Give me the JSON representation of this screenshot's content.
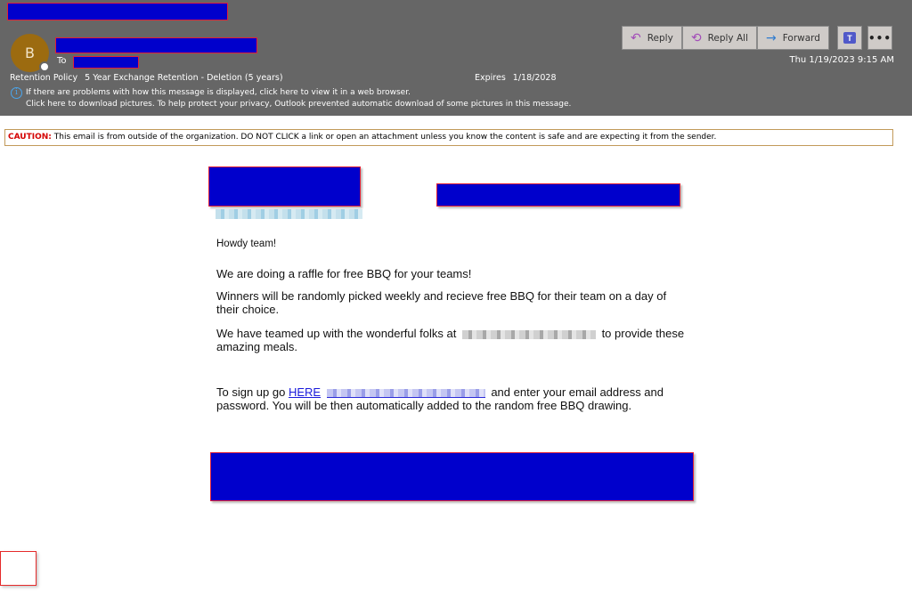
{
  "header": {
    "avatar_initial": "B",
    "to_label": "To",
    "retention_label": "Retention Policy",
    "retention_value": "5 Year Exchange Retention - Deletion (5 years)",
    "expires_label": "Expires",
    "expires_value": "1/18/2028",
    "info_line1": "If there are problems with how this message is displayed, click here to view it in a web browser.",
    "info_line2": "Click here to download pictures. To help protect your privacy, Outlook prevented automatic download of some pictures in this message.",
    "date": "Thu 1/19/2023 9:15 AM",
    "buttons": {
      "reply": "Reply",
      "reply_all": "Reply All",
      "forward": "Forward",
      "more": "•••"
    },
    "icons": {
      "reply": "↶",
      "reply_all": "⟲",
      "forward": "→",
      "info": "i",
      "teams": "T"
    }
  },
  "caution": {
    "label": "CAUTION:",
    "text": " This email is from outside of the organization. DO NOT CLICK a link or open an attachment unless you know the content is safe and are expecting it from the sender."
  },
  "message": {
    "greeting": "Howdy team!",
    "para1": "We are doing a raffle for free BBQ for your teams!",
    "para2": "Winners will be randomly picked weekly and recieve free BBQ for their team on a day of their choice.",
    "para3_before": "We have teamed up with the wonderful folks at",
    "para3_after": "to provide these amazing meals.",
    "para4_before": "To sign up go ",
    "para4_link": "HERE",
    "para4_after": "and enter your email address and password. You will be then automatically added to the random free BBQ drawing."
  }
}
